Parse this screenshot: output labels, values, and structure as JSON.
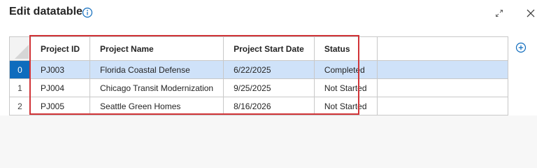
{
  "dialog": {
    "title": "Edit datatable"
  },
  "table": {
    "columns": [
      "Project ID",
      "Project Name",
      "Project Start Date",
      "Status"
    ],
    "rows": [
      {
        "index": "0",
        "cells": [
          "PJ003",
          "Florida Coastal Defense",
          "6/22/2025",
          "Completed"
        ],
        "selected": true
      },
      {
        "index": "1",
        "cells": [
          "PJ004",
          "Chicago Transit Modernization",
          "9/25/2025",
          "Not Started"
        ],
        "selected": false
      },
      {
        "index": "2",
        "cells": [
          "PJ005",
          "Seattle Green Homes",
          "8/16/2026",
          "Not Started"
        ],
        "selected": false
      }
    ]
  },
  "icons": {
    "info": "info-icon",
    "expand": "expand-icon",
    "close": "close-icon",
    "add_column": "add-circle-icon"
  },
  "colors": {
    "accent": "#0f6cbd",
    "selection": "#cfe2f9",
    "highlight": "#d13438"
  }
}
